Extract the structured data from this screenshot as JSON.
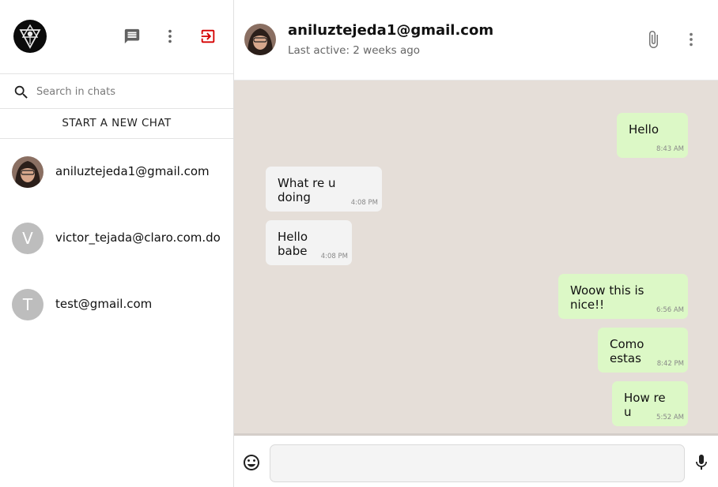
{
  "sidebar": {
    "search_placeholder": "Search in chats",
    "new_chat_label": "START A NEW CHAT",
    "chats": [
      {
        "name": "aniluztejeda1@gmail.com",
        "avatar": "photo"
      },
      {
        "name": "victor_tejada@claro.com.do",
        "avatar_letter": "V"
      },
      {
        "name": "test@gmail.com",
        "avatar_letter": "T"
      }
    ]
  },
  "conversation": {
    "contact": "aniluztejeda1@gmail.com",
    "last_active": "Last active: 2 weeks ago",
    "messages": [
      {
        "text": "Hello",
        "time": "8:43 AM",
        "direction": "out"
      },
      {
        "text": "What re u doing",
        "time": "4:08 PM",
        "direction": "in"
      },
      {
        "text": "Hello babe",
        "time": "4:08 PM",
        "direction": "in"
      },
      {
        "text": "Woow this is nice!!",
        "time": "6:56 AM",
        "direction": "out"
      },
      {
        "text": "Como estas",
        "time": "8:42 PM",
        "direction": "out"
      },
      {
        "text": "How re u",
        "time": "5:52 AM",
        "direction": "out"
      }
    ]
  },
  "composer": {
    "value": ""
  },
  "colors": {
    "logout_icon": "#d50000",
    "outgoing_bubble": "#dcf8c6",
    "incoming_bubble": "#f3f3f3",
    "chat_background": "#e5ded8",
    "avatar_letter_bg": "#bdbdbd"
  },
  "icons": [
    "logo",
    "chat-icon",
    "more-vert-icon",
    "logout-icon",
    "search-icon",
    "attach-icon",
    "emoji-icon",
    "mic-icon"
  ]
}
